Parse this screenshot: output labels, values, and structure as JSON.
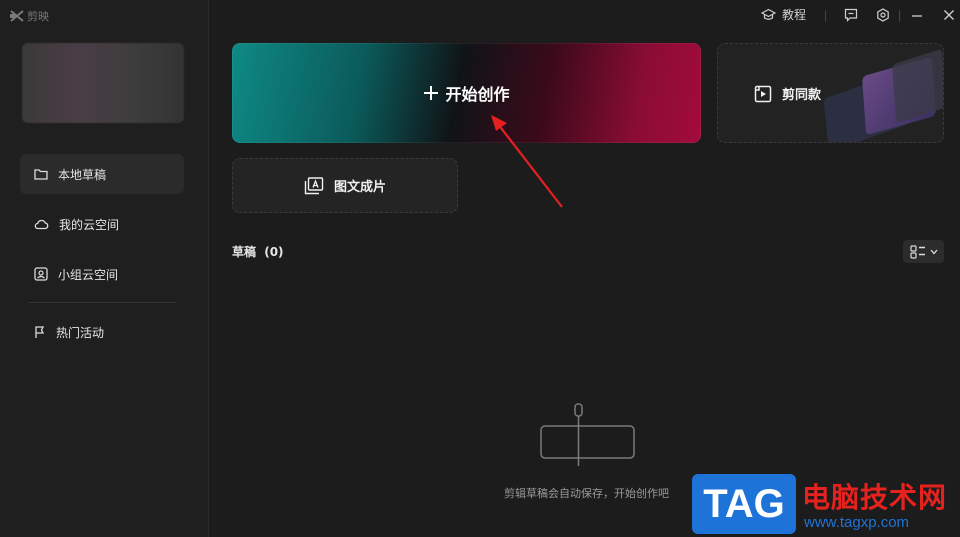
{
  "app": {
    "brand": "剪映"
  },
  "titlebar": {
    "tutorial_label": "教程"
  },
  "sidebar": {
    "items": [
      {
        "label": "本地草稿",
        "icon": "folder-icon"
      },
      {
        "label": "我的云空间",
        "icon": "cloud-icon"
      },
      {
        "label": "小组云空间",
        "icon": "group-space-icon"
      },
      {
        "label": "热门活动",
        "icon": "flag-icon"
      }
    ]
  },
  "main": {
    "start_create_label": "开始创作",
    "same_style_label": "剪同款",
    "image_text_label": "图文成片",
    "drafts_title": "草稿",
    "drafts_count": "(0)",
    "empty_text": "剪辑草稿会自动保存，开始创作吧"
  },
  "watermark": {
    "tag": "TAG",
    "cn": "电脑技术网",
    "url": "www.tagxp.com"
  },
  "colors": {
    "accent_red": "#e6221f",
    "watermark_blue": "#1e73d8"
  }
}
